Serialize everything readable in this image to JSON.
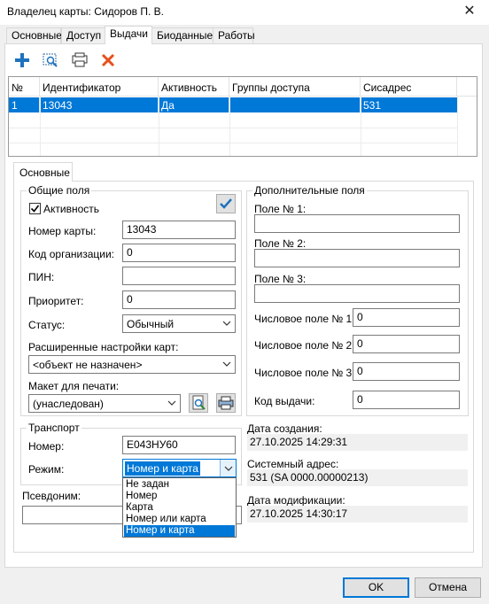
{
  "window": {
    "title": "Владелец карты: Сидоров П. В.",
    "close_glyph": "✕"
  },
  "tabs": [
    "Основные",
    "Доступ",
    "Выдачи",
    "Биоданные",
    "Работы"
  ],
  "active_tab": "Выдачи",
  "toolbar": {
    "icons": [
      "add-icon",
      "search-icon",
      "print-icon",
      "delete-icon"
    ]
  },
  "table": {
    "columns": [
      "№",
      "Идентификатор",
      "Активность",
      "Группы доступа",
      "Сисадрес"
    ],
    "rows": [
      {
        "num": "1",
        "id": "13043",
        "active": "Да",
        "groups": "",
        "sysaddr": "531"
      }
    ]
  },
  "subtab": "Основные",
  "general": {
    "title": "Общие поля",
    "active_label": "Активность",
    "active_checked": true,
    "card_number_label": "Номер карты:",
    "card_number": "13043",
    "org_code_label": "Код организации:",
    "org_code": "0",
    "pin_label": "ПИН:",
    "pin": "",
    "priority_label": "Приоритет:",
    "priority": "0",
    "status_label": "Статус:",
    "status": "Обычный",
    "ext_label": "Расширенные настройки карт:",
    "ext_value": "<объект не назначен>",
    "layout_label": "Макет для печати:",
    "layout_value": "(унаследован)"
  },
  "extra": {
    "title": "Дополнительные поля",
    "field1_label": "Поле № 1:",
    "field2_label": "Поле № 2:",
    "field3_label": "Поле № 3:",
    "num1_label": "Числовое поле № 1:",
    "num1": "0",
    "num2_label": "Числовое поле № 2:",
    "num2": "0",
    "num3_label": "Числовое поле № 3:",
    "num3": "0",
    "issue_code_label": "Код выдачи:",
    "issue_code": "0"
  },
  "transport": {
    "title": "Транспорт",
    "number_label": "Номер:",
    "number": "Е043НУ60",
    "mode_label": "Режим:",
    "mode": "Номер и карта",
    "options": [
      "Не задан",
      "Номер",
      "Карта",
      "Номер или карта",
      "Номер и карта"
    ],
    "selected_index": 4
  },
  "alias_label": "Псевдоним:",
  "info": {
    "created_label": "Дата создания:",
    "created": "27.10.2025 14:29:31",
    "sysaddr_label": "Системный адрес:",
    "sysaddr": "531 (SA 0000.00000213)",
    "modified_label": "Дата модификации:",
    "modified": "27.10.2025 14:30:17"
  },
  "buttons": {
    "ok": "OK",
    "cancel": "Отмена"
  }
}
